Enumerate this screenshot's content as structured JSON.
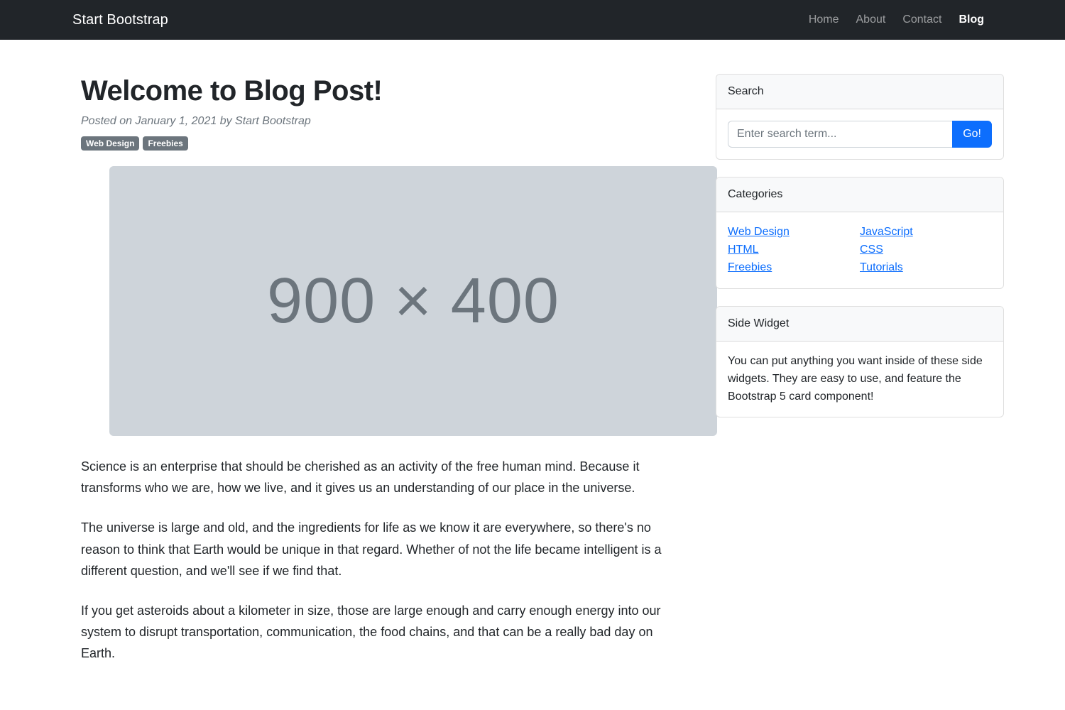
{
  "navbar": {
    "brand": "Start Bootstrap",
    "items": [
      {
        "label": "Home",
        "active": false
      },
      {
        "label": "About",
        "active": false
      },
      {
        "label": "Contact",
        "active": false
      },
      {
        "label": "Blog",
        "active": true
      }
    ]
  },
  "post": {
    "title": "Welcome to Blog Post!",
    "meta": "Posted on January 1, 2021 by Start Bootstrap",
    "badges": [
      "Web Design",
      "Freebies"
    ],
    "featured_image_placeholder": "900 × 400",
    "paragraphs": [
      "Science is an enterprise that should be cherished as an activity of the free human mind. Because it transforms who we are, how we live, and it gives us an understanding of our place in the universe.",
      "The universe is large and old, and the ingredients for life as we know it are everywhere, so there's no reason to think that Earth would be unique in that regard. Whether of not the life became intelligent is a different question, and we'll see if we find that.",
      "If you get asteroids about a kilometer in size, those are large enough and carry enough energy into our system to disrupt transportation, communication, the food chains, and that can be a really bad day on Earth."
    ]
  },
  "sidebar": {
    "search": {
      "header": "Search",
      "placeholder": "Enter search term...",
      "value": "",
      "button_label": "Go!"
    },
    "categories": {
      "header": "Categories",
      "column_left": [
        "Web Design",
        "HTML",
        "Freebies"
      ],
      "column_right": [
        "JavaScript",
        "CSS",
        "Tutorials"
      ]
    },
    "side_widget": {
      "header": "Side Widget",
      "text": "You can put anything you want inside of these side widgets. They are easy to use, and feature the Bootstrap 5 card component!"
    }
  },
  "colors": {
    "navbar_bg": "#212529",
    "primary": "#0d6efd",
    "badge_bg": "#6c757d",
    "placeholder_bg": "#ced4da",
    "card_header_bg": "#f8f9fa",
    "muted_text": "#6c757d"
  }
}
